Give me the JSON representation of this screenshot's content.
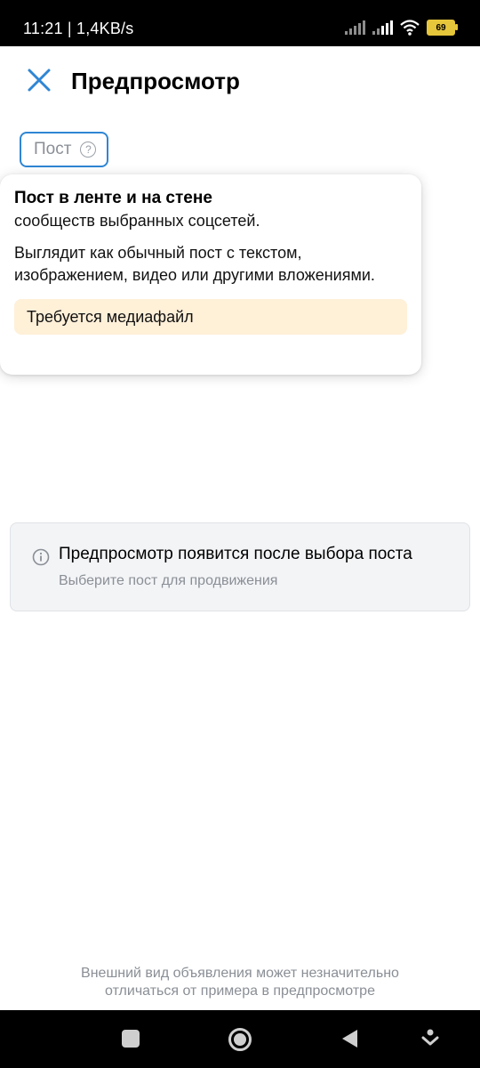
{
  "status_bar": {
    "time": "11:21 | 1,4KB/s",
    "battery": "69"
  },
  "header": {
    "title": "Предпросмотр"
  },
  "chip": {
    "label": "Пост",
    "help": "?"
  },
  "tooltip": {
    "title": "Пост в ленте и на стене",
    "subtitle": "сообществ выбранных соцсетей.",
    "description": "Выглядит как обычный пост с текстом, изображением, видео или другими вложениями.",
    "warning": "Требуется медиафайл"
  },
  "info_card": {
    "title": "Предпросмотр появится после выбора поста",
    "subtitle": "Выберите пост для продвижения"
  },
  "footer": {
    "note_line1": "Внешний вид объявления может незначительно",
    "note_line2": "отличаться от примера в предпросмотре"
  },
  "colors": {
    "accent": "#2f86d4",
    "warning_bg": "#fff0d8",
    "muted_text": "#8a8f96"
  }
}
